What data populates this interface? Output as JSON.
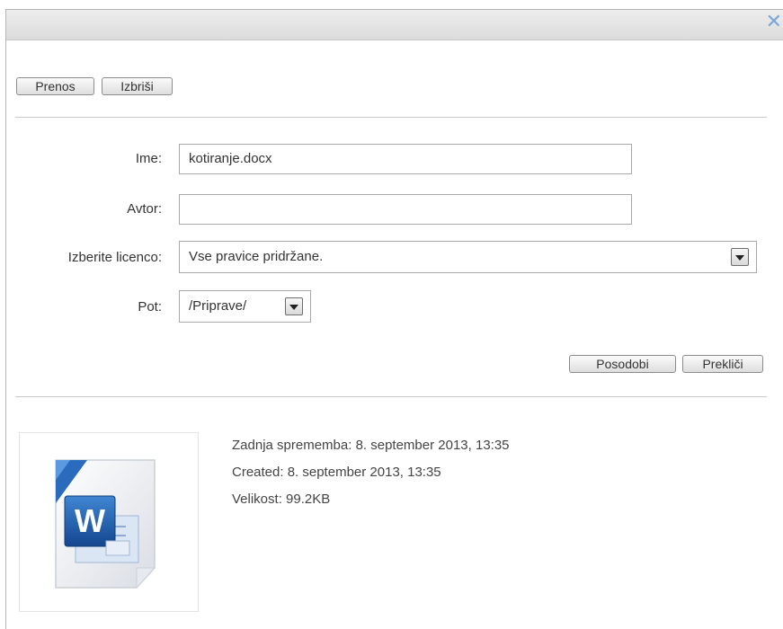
{
  "toolbar": {
    "download_label": "Prenos",
    "delete_label": "Izbriši"
  },
  "form": {
    "name_label": "Ime:",
    "name_value": "kotiranje.docx",
    "author_label": "Avtor:",
    "author_value": "",
    "license_label": "Izberite licenco:",
    "license_value": "Vse pravice pridržane.",
    "path_label": "Pot:",
    "path_value": "/Priprave/"
  },
  "actions": {
    "update_label": "Posodobi",
    "cancel_label": "Prekliči"
  },
  "file_info": {
    "modified": "Zadnja sprememba: 8. september 2013, 13:35",
    "created": "Created: 8. september 2013, 13:35",
    "size": "Velikost: 99.2KB"
  },
  "icons": {
    "close": "close-icon",
    "file": "word-document-icon"
  },
  "colors": {
    "close_icon": "#7aa6da",
    "word_blue": "#1e63b0"
  }
}
